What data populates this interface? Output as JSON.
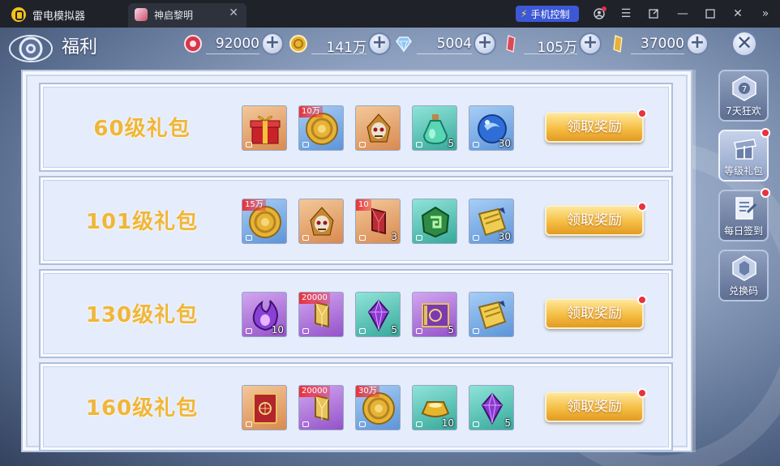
{
  "titlebar": {
    "app_name": "雷电模拟器",
    "tab_label": "神启黎明",
    "phone_control": "手机控制"
  },
  "header": {
    "title": "福利",
    "currencies": [
      {
        "name": "red-gem",
        "value": "92000",
        "color": "#d8364a"
      },
      {
        "name": "gold-coin",
        "value": "141万",
        "color": "#e8b233"
      },
      {
        "name": "diamond",
        "value": "5004",
        "color": "#7fb9ef"
      },
      {
        "name": "red-crystal",
        "value": "105万",
        "color": "#d94b56"
      },
      {
        "name": "gold-crystal",
        "value": "37000",
        "color": "#e6b23b"
      }
    ]
  },
  "packs": [
    {
      "title": "60级礼包",
      "button": "领取奖励",
      "items": [
        {
          "icon": "gift-box-icon",
          "bg": "orange",
          "badge": "",
          "qty": ""
        },
        {
          "icon": "gold-coin-icon",
          "bg": "blue",
          "badge": "10万",
          "qty": ""
        },
        {
          "icon": "skull-helmet-icon",
          "bg": "orange",
          "badge": "",
          "qty": ""
        },
        {
          "icon": "potion-bottle-icon",
          "bg": "teal",
          "badge": "",
          "qty": "5"
        },
        {
          "icon": "blue-orb-icon",
          "bg": "blue",
          "badge": "",
          "qty": "30"
        }
      ]
    },
    {
      "title": "101级礼包",
      "button": "领取奖励",
      "items": [
        {
          "icon": "gold-coin-icon",
          "bg": "blue",
          "badge": "15万",
          "qty": ""
        },
        {
          "icon": "skull-helmet-icon",
          "bg": "orange",
          "badge": "",
          "qty": ""
        },
        {
          "icon": "red-crystal-icon",
          "bg": "orange",
          "badge": "10",
          "qty": "3"
        },
        {
          "icon": "green-rune-icon",
          "bg": "teal",
          "badge": "",
          "qty": ""
        },
        {
          "icon": "gold-scroll-icon",
          "bg": "blue",
          "badge": "",
          "qty": "30"
        }
      ]
    },
    {
      "title": "130级礼包",
      "button": "领取奖励",
      "items": [
        {
          "icon": "purple-flame-icon",
          "bg": "purple",
          "badge": "",
          "qty": "10"
        },
        {
          "icon": "gold-crystal-icon",
          "bg": "purple",
          "badge": "20000",
          "qty": ""
        },
        {
          "icon": "purple-gem-icon",
          "bg": "teal",
          "badge": "",
          "qty": "5"
        },
        {
          "icon": "spell-book-icon",
          "bg": "purple",
          "badge": "",
          "qty": "5"
        },
        {
          "icon": "gold-scroll-icon",
          "bg": "blue",
          "badge": "",
          "qty": ""
        }
      ]
    },
    {
      "title": "160级礼包",
      "button": "领取奖励",
      "items": [
        {
          "icon": "red-card-icon",
          "bg": "orange",
          "badge": "",
          "qty": ""
        },
        {
          "icon": "gold-crystal-icon",
          "bg": "purple",
          "badge": "20000",
          "qty": ""
        },
        {
          "icon": "gold-coin-icon",
          "bg": "blue",
          "badge": "30万",
          "qty": ""
        },
        {
          "icon": "gold-ingot-icon",
          "bg": "teal",
          "badge": "",
          "qty": "10"
        },
        {
          "icon": "purple-gem-icon",
          "bg": "teal",
          "badge": "",
          "qty": "5"
        }
      ]
    }
  ],
  "side_tabs": [
    {
      "label": "7天狂欢",
      "icon": "seven-day-badge-icon",
      "active": false,
      "dot": false
    },
    {
      "label": "等级礼包",
      "icon": "level-gift-icon",
      "active": true,
      "dot": true
    },
    {
      "label": "每日签到",
      "icon": "daily-checkin-icon",
      "active": false,
      "dot": true
    },
    {
      "label": "兑换码",
      "icon": "redeem-code-icon",
      "active": false,
      "dot": false
    }
  ],
  "seven_day_number": "7"
}
